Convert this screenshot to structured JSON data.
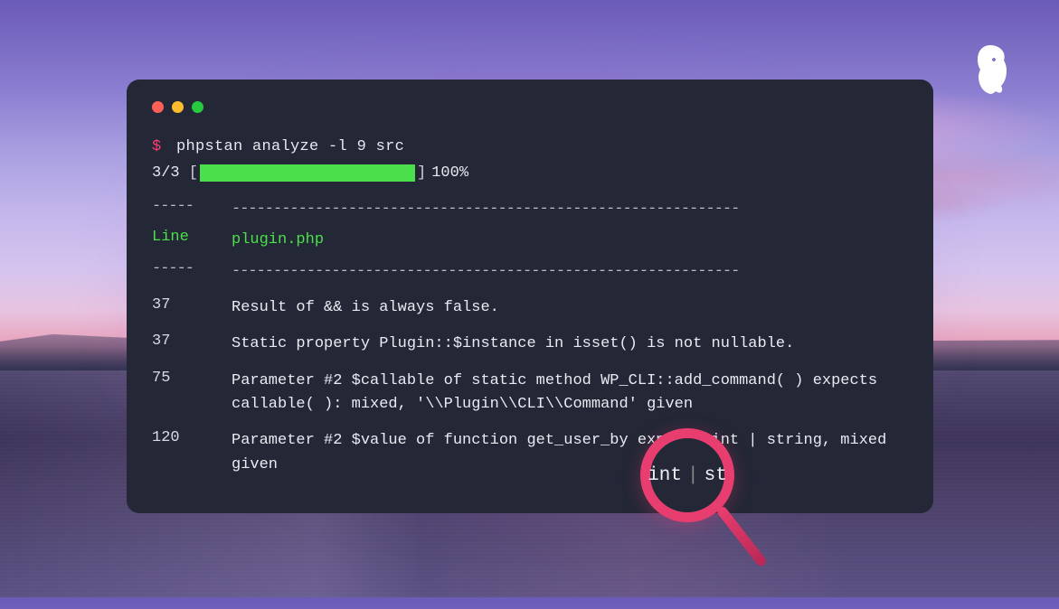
{
  "command": {
    "prompt": "$",
    "text": "phpstan analyze -l 9 src"
  },
  "progress": {
    "count": "3/3",
    "pct": "100%"
  },
  "header": {
    "dash1": "-----",
    "dash2": "-------------------------------------------------------------",
    "col1": "Line",
    "col2": "plugin.php"
  },
  "errors": [
    {
      "line": "37",
      "msg": "Result of && is always false."
    },
    {
      "line": "37",
      "msg": "Static property Plugin::$instance in isset() is not nullable."
    },
    {
      "line": "75",
      "msg": "Parameter #2 $callable of static method WP_CLI::add_command( ) expects callable( ): mixed, '\\\\Plugin\\\\CLI\\\\Command' given"
    },
    {
      "line": "120",
      "msg": "Parameter #2 $value of function get_user_by expects int | string, mixed given"
    }
  ],
  "magnifier": {
    "left": "int",
    "right": "st"
  }
}
